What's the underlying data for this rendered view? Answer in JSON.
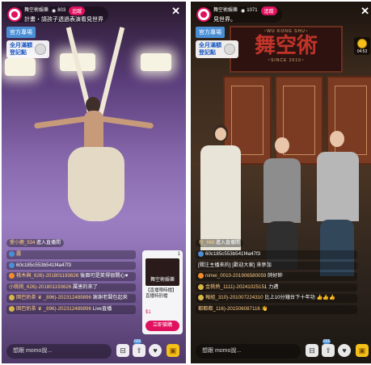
{
  "left": {
    "host_name": "舞空術娛樂",
    "viewers": "803",
    "follow_label": "追蹤",
    "subtitle": "計畫・請孩子透過表演看見世界",
    "tag": "官方專場",
    "subscribe": [
      "全月滿額",
      "登記點"
    ],
    "join_notice": {
      "name": "愛小鹿_534",
      "text": " 進入直播間"
    },
    "chat": [
      {
        "badge": "blue",
        "name": "露",
        "text": ""
      },
      {
        "badge": "blue",
        "name": "",
        "text": "60c185c553b541f4a47f3"
      },
      {
        "badge": "orange",
        "name": "桃木與_626)-201801193626",
        "text": " 後面可是笑得很開心♥"
      },
      {
        "badge": "",
        "name": "小桃桃_626)-201801193626",
        "text": " 厲害的來了"
      },
      {
        "badge": "gold",
        "name": "固巴奶茶 ♛ _896)-202312489896",
        "text": " 謝謝老闆包起來"
      },
      {
        "badge": "gold",
        "name": "固巴奶茶 ♛ _896)-202312489896",
        "text": " Live直播"
      }
    ],
    "promo": {
      "count_left": "",
      "count_right": "1",
      "img_text": "舞空術娛樂",
      "title": "【直播限時檔】直播特別檔",
      "price": "$1",
      "buy_label": "立即搶購"
    },
    "input_placeholder": "想跟 momo說...",
    "icons": {
      "share_count": "666"
    }
  },
  "right": {
    "host_name": "舞空術娛樂",
    "viewers": "1071",
    "follow_label": "追蹤",
    "subtitle": "見世界。",
    "tag": "官方專場",
    "subscribe": [
      "全月滿額",
      "登記點"
    ],
    "banner": {
      "small": "~WU KONG SHU~",
      "big": "舞空術",
      "since": "~SINCE 2016~"
    },
    "counter_time": "04:53",
    "join_notice": {
      "name": "桂_668",
      "text": " 進入直播間"
    },
    "chat": [
      {
        "badge": "blue",
        "name": "",
        "text": "60c185c553b541f4a47f3"
      },
      {
        "badge": "",
        "name": "",
        "text": "[關注主播來的] [歡迎大家] 來參加"
      },
      {
        "badge": "orange",
        "name": "nimei_0010-201906580059",
        "text": " 帥好帥"
      },
      {
        "badge": "gold",
        "name": "金桃熱_1111)-2024102515",
        "text": "1 力邁"
      },
      {
        "badge": "gold",
        "name": "報組_310)-201007224310",
        "text": " 比上10分鐘台下十年功 👍👍👍"
      },
      {
        "badge": "",
        "name": "都都都_116)-201506087116",
        "text": " 👋"
      }
    ],
    "input_placeholder": "想跟 momo說...",
    "icons": {
      "share_count": "666"
    }
  }
}
